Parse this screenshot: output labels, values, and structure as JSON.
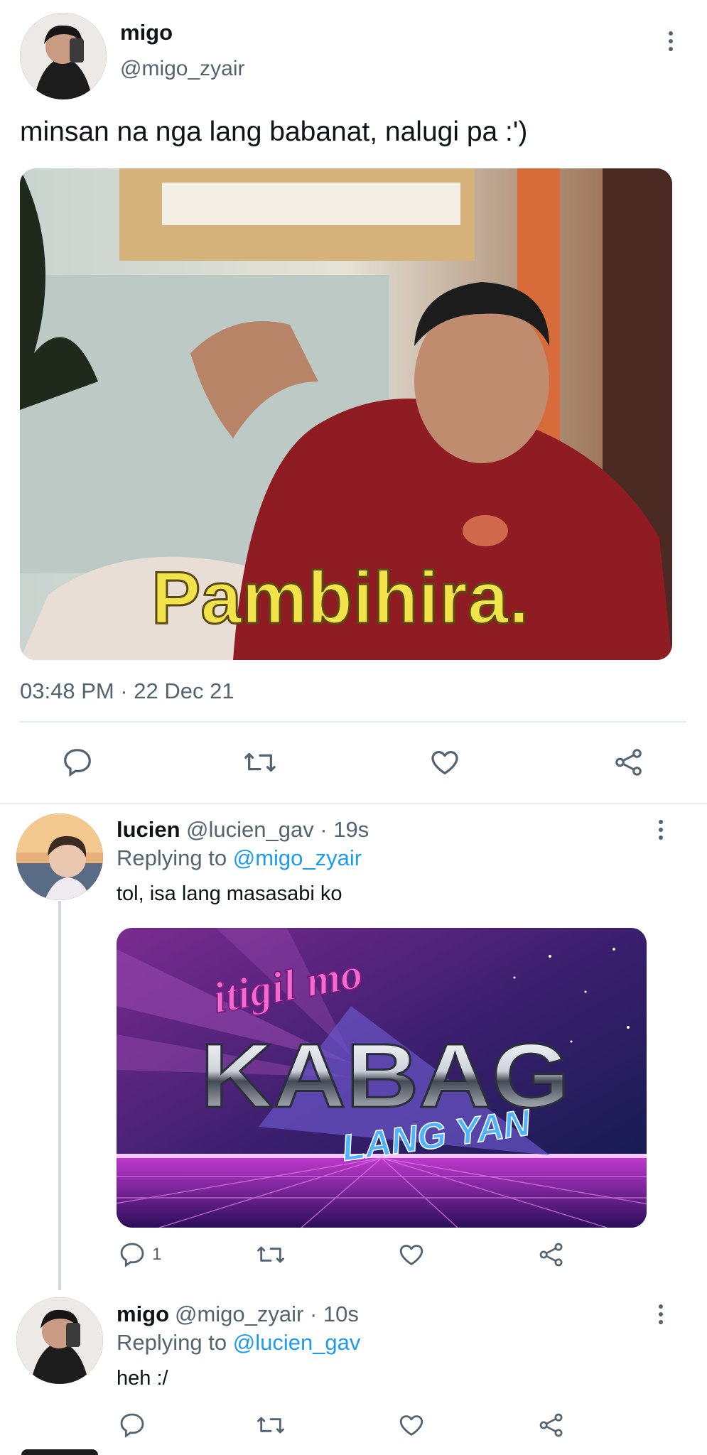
{
  "main_tweet": {
    "name": "migo",
    "handle": "@migo_zyair",
    "text": "minsan na nga lang babanat, nalugi pa :')",
    "image_caption": "Pambihira.",
    "timestamp": "03:48 PM · 22 Dec 21"
  },
  "reply1": {
    "name": "lucien",
    "handle_time": "@lucien_gav · 19s",
    "replying_prefix": "Replying to",
    "replying_to": "@migo_zyair",
    "text": "tol, isa lang masasabi ko",
    "image_text": {
      "line1": "itigil mo",
      "line2": "KABAG",
      "line3": "LANG YAN"
    },
    "reply_count": "1"
  },
  "reply2": {
    "name": "migo",
    "handle_time": "@migo_zyair · 10s",
    "replying_prefix": "Replying to",
    "replying_to": "@lucien_gav",
    "text": "heh :/"
  },
  "colors": {
    "accent": "#1d9bf0",
    "muted": "#536471",
    "divider": "#e6ecf0"
  },
  "icons": [
    "reply-icon",
    "retweet-icon",
    "like-icon",
    "share-icon",
    "more-icon"
  ]
}
